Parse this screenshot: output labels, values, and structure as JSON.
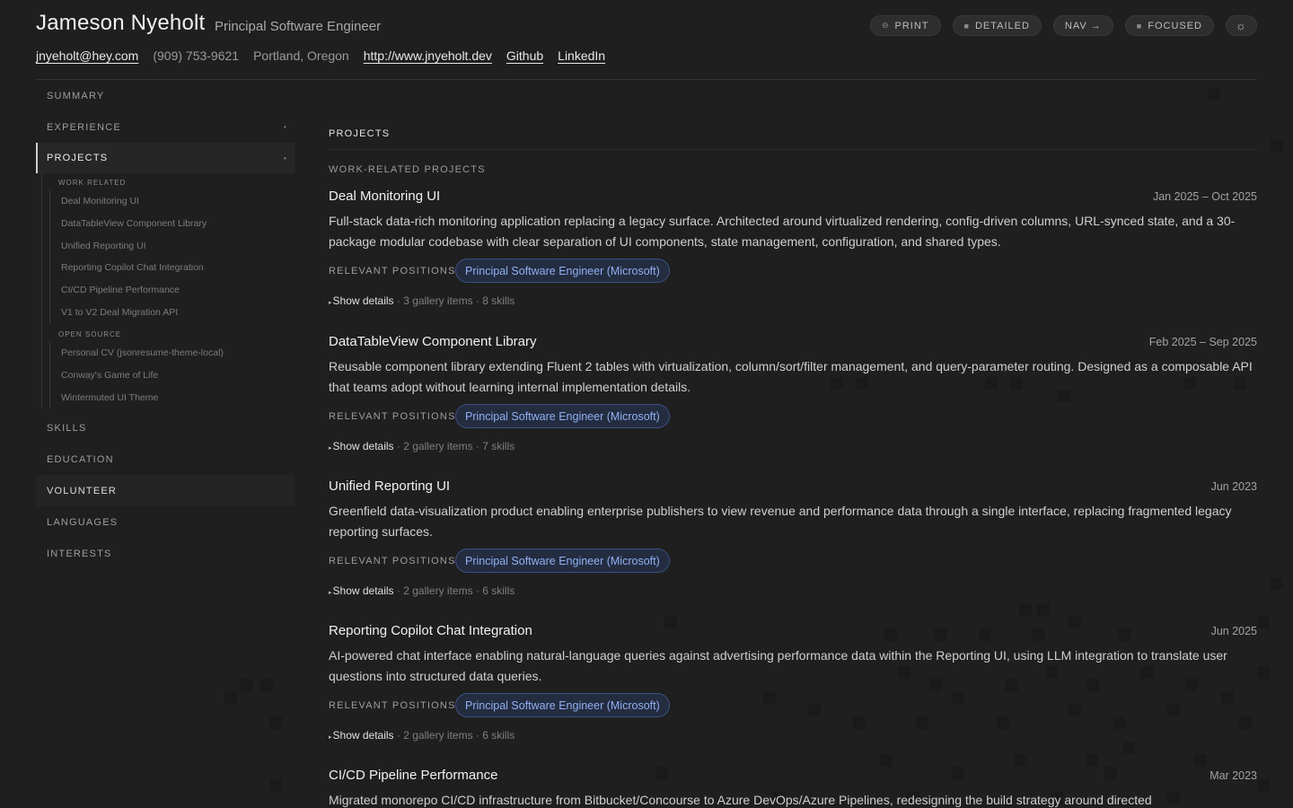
{
  "header": {
    "name": "Jameson Nyeholt",
    "role": "Principal Software Engineer",
    "email": "jnyeholt@hey.com",
    "phone": "(909) 753-9621",
    "location": "Portland, Oregon",
    "website": "http://www.jnyeholt.dev",
    "github": "Github",
    "linkedin": "LinkedIn",
    "controls": {
      "print": "PRINT",
      "detailed": "DETAILED",
      "nav": "NAV →",
      "focused": "FOCUSED",
      "theme_icon": "sun-icon"
    }
  },
  "sidebar": {
    "items": [
      {
        "label": "SUMMARY"
      },
      {
        "label": "EXPERIENCE",
        "marker": "•"
      },
      {
        "label": "PROJECTS",
        "marker": "•"
      },
      {
        "label": "SKILLS"
      },
      {
        "label": "EDUCATION"
      },
      {
        "label": "VOLUNTEER"
      },
      {
        "label": "LANGUAGES"
      },
      {
        "label": "INTERESTS"
      }
    ],
    "work_related_heading": "WORK RELATED",
    "work_related": [
      "Deal Monitoring UI",
      "DataTableView Component Library",
      "Unified Reporting UI",
      "Reporting Copilot Chat Integration",
      "CI/CD Pipeline Performance",
      "V1 to V2 Deal Migration API"
    ],
    "open_source_heading": "OPEN SOURCE",
    "open_source": [
      "Personal CV (jsonresume-theme-local)",
      "Conway's Game of Life",
      "Wintermuted UI Theme"
    ]
  },
  "main": {
    "section_title": "PROJECTS",
    "subsection_title": "WORK-RELATED PROJECTS",
    "relevant_positions_label": "RELEVANT POSITIONS",
    "show_details_label": "Show details",
    "projects": [
      {
        "title": "Deal Monitoring UI",
        "date": "Jan 2025 – Oct 2025",
        "desc": "Full-stack data-rich monitoring application replacing a legacy surface. Architected around virtualized rendering, config-driven columns, URL-synced state, and a 30-package modular codebase with clear separation of UI components, state management, configuration, and shared types.",
        "position": "Principal Software Engineer (Microsoft)",
        "meta": " · 3 gallery items · 8 skills"
      },
      {
        "title": "DataTableView Component Library",
        "date": "Feb 2025 – Sep 2025",
        "desc": "Reusable component library extending Fluent 2 tables with virtualization, column/sort/filter management, and query-parameter routing. Designed as a composable API that teams adopt without learning internal implementation details.",
        "position": "Principal Software Engineer (Microsoft)",
        "meta": " · 2 gallery items · 7 skills"
      },
      {
        "title": "Unified Reporting UI",
        "date": "Jun 2023",
        "desc": "Greenfield data-visualization product enabling enterprise publishers to view revenue and performance data through a single interface, replacing fragmented legacy reporting surfaces.",
        "position": "Principal Software Engineer (Microsoft)",
        "meta": " · 2 gallery items · 6 skills"
      },
      {
        "title": "Reporting Copilot Chat Integration",
        "date": "Jun 2025",
        "desc": "AI-powered chat interface enabling natural-language queries against advertising performance data within the Reporting UI, using LLM integration to translate user questions into structured data queries.",
        "position": "Principal Software Engineer (Microsoft)",
        "meta": " · 2 gallery items · 6 skills"
      },
      {
        "title": "CI/CD Pipeline Performance",
        "date": "Mar 2023",
        "desc": "Migrated monorepo CI/CD infrastructure from Bitbucket/Concourse to Azure DevOps/Azure Pipelines, redesigning the build strategy around directed"
      }
    ]
  }
}
